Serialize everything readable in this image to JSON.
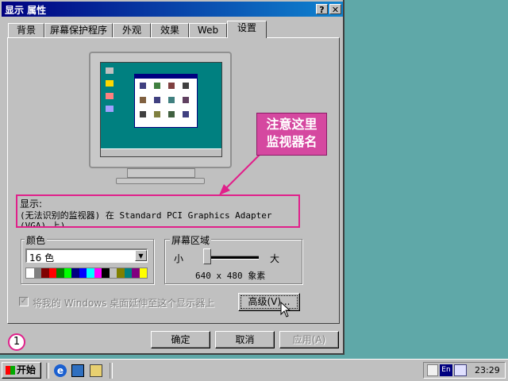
{
  "window": {
    "title": "显示 属性",
    "help_glyph": "?",
    "close_glyph": "✕"
  },
  "tabs": [
    {
      "label": "背景"
    },
    {
      "label": "屏幕保护程序"
    },
    {
      "label": "外观"
    },
    {
      "label": "效果"
    },
    {
      "label": "Web"
    },
    {
      "label": "设置",
      "active": true
    }
  ],
  "annotation": {
    "callout_line1": "注意这里",
    "callout_line2": "监视器名",
    "color": "#e0208a"
  },
  "display": {
    "label": "显示:",
    "value": "(无法识别的监视器) 在 Standard PCI Graphics Adapter (VGA) 上)"
  },
  "colors": {
    "group_label": "颜色",
    "selected": "16 色",
    "palette": [
      "#ffffff",
      "#808080",
      "#800000",
      "#ff0000",
      "#008000",
      "#00ff00",
      "#000080",
      "#0000ff",
      "#00ffff",
      "#ff00ff",
      "#000000",
      "#c0c0c0",
      "#808000",
      "#008080",
      "#800080",
      "#ffff00"
    ]
  },
  "screen_area": {
    "group_label": "屏幕区域",
    "min_label": "小",
    "max_label": "大",
    "resolution": "640 x 480 象素",
    "slider_fraction": 0
  },
  "extend_checkbox": {
    "label": "将我的 Windows 桌面延伸至这个显示器上",
    "checked": true,
    "enabled": false
  },
  "buttons": {
    "advanced": "高级(V)...",
    "ok": "确定",
    "cancel": "取消",
    "apply": "应用(A)"
  },
  "step_marker": "1",
  "taskbar": {
    "start_label": "开始",
    "ime_label": "En",
    "clock": "23:29"
  },
  "accent_colors": {
    "titlebar": "#000080",
    "desktop": "#5fa8a8"
  }
}
